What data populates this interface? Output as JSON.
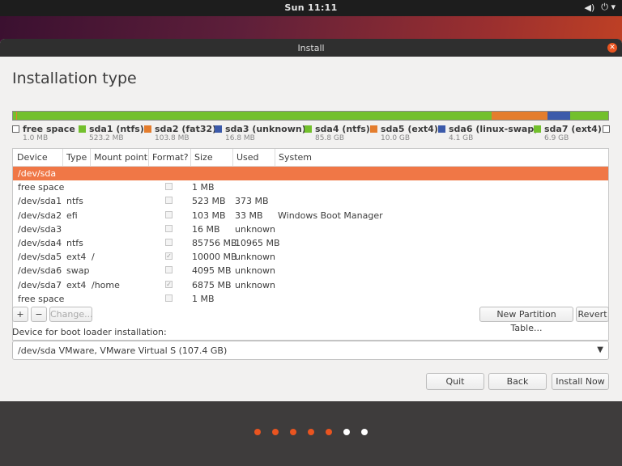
{
  "topbar": {
    "clock": "Sun 11:11"
  },
  "window": {
    "title": "Install",
    "page_title": "Installation type"
  },
  "partition_bar": [
    {
      "color": "#ffffff",
      "fraction": 0.0004
    },
    {
      "color": "#73c02d",
      "fraction": 0.0049
    },
    {
      "color": "#e47d2d",
      "fraction": 0.001
    },
    {
      "color": "#3c5aaa",
      "fraction": 0.0002
    },
    {
      "color": "#73c02d",
      "fraction": 0.798
    },
    {
      "color": "#e47d2d",
      "fraction": 0.093
    },
    {
      "color": "#3c5aaa",
      "fraction": 0.038
    },
    {
      "color": "#73c02d",
      "fraction": 0.064
    }
  ],
  "legend": [
    {
      "name": "free space",
      "size": "1.0 MB",
      "color": "#ffffff"
    },
    {
      "name": "sda1 (ntfs)",
      "size": "523.2 MB",
      "color": "#73c02d"
    },
    {
      "name": "sda2 (fat32)",
      "size": "103.8 MB",
      "color": "#e47d2d"
    },
    {
      "name": "sda3 (unknown)",
      "size": "16.8 MB",
      "color": "#3c5aaa"
    },
    {
      "name": "sda4 (ntfs)",
      "size": "85.8 GB",
      "color": "#73c02d"
    },
    {
      "name": "sda5 (ext4)",
      "size": "10.0 GB",
      "color": "#e47d2d"
    },
    {
      "name": "sda6 (linux-swap)",
      "size": "4.1 GB",
      "color": "#3c5aaa"
    },
    {
      "name": "sda7 (ext4)",
      "size": "6.9 GB",
      "color": "#73c02d"
    },
    {
      "name": "",
      "size": "",
      "color": "#ffffff"
    }
  ],
  "table": {
    "headers": [
      "Device",
      "Type",
      "Mount point",
      "Format?",
      "Size",
      "Used",
      "System"
    ],
    "rows": [
      {
        "device": "/dev/sda",
        "type": "",
        "mount": "",
        "format": "",
        "size": "",
        "used": "",
        "system": "",
        "selected": true
      },
      {
        "device": "free space",
        "type": "",
        "mount": "",
        "format": "box",
        "size": "1 MB",
        "used": "",
        "system": ""
      },
      {
        "device": "/dev/sda1",
        "type": "ntfs",
        "mount": "",
        "format": "box",
        "size": "523 MB",
        "used": "373 MB",
        "system": ""
      },
      {
        "device": "/dev/sda2",
        "type": "efi",
        "mount": "",
        "format": "box",
        "size": "103 MB",
        "used": "33 MB",
        "system": "Windows Boot Manager"
      },
      {
        "device": "/dev/sda3",
        "type": "",
        "mount": "",
        "format": "box",
        "size": "16 MB",
        "used": "unknown",
        "system": ""
      },
      {
        "device": "/dev/sda4",
        "type": "ntfs",
        "mount": "",
        "format": "box",
        "size": "85756 MB",
        "used": "10965 MB",
        "system": ""
      },
      {
        "device": "/dev/sda5",
        "type": "ext4",
        "mount": "/",
        "format": "checked",
        "size": "10000 MB",
        "used": "unknown",
        "system": ""
      },
      {
        "device": "/dev/sda6",
        "type": "swap",
        "mount": "",
        "format": "box",
        "size": "4095 MB",
        "used": "unknown",
        "system": ""
      },
      {
        "device": "/dev/sda7",
        "type": "ext4",
        "mount": "/home",
        "format": "checked",
        "size": "6875 MB",
        "used": "unknown",
        "system": ""
      },
      {
        "device": "free space",
        "type": "",
        "mount": "",
        "format": "box",
        "size": "1 MB",
        "used": "",
        "system": ""
      }
    ]
  },
  "toolbar": {
    "add": "+",
    "remove": "−",
    "change": "Change...",
    "new_table": "New Partition Table...",
    "revert": "Revert"
  },
  "boot": {
    "label": "Device for boot loader installation:",
    "value": "/dev/sda   VMware, VMware Virtual S (107.4 GB)"
  },
  "actions": {
    "quit": "Quit",
    "back": "Back",
    "install": "Install Now"
  },
  "progress_dots": {
    "total": 7,
    "completed": 5,
    "active_color": "#e95420",
    "inactive_color": "#ffffff"
  }
}
